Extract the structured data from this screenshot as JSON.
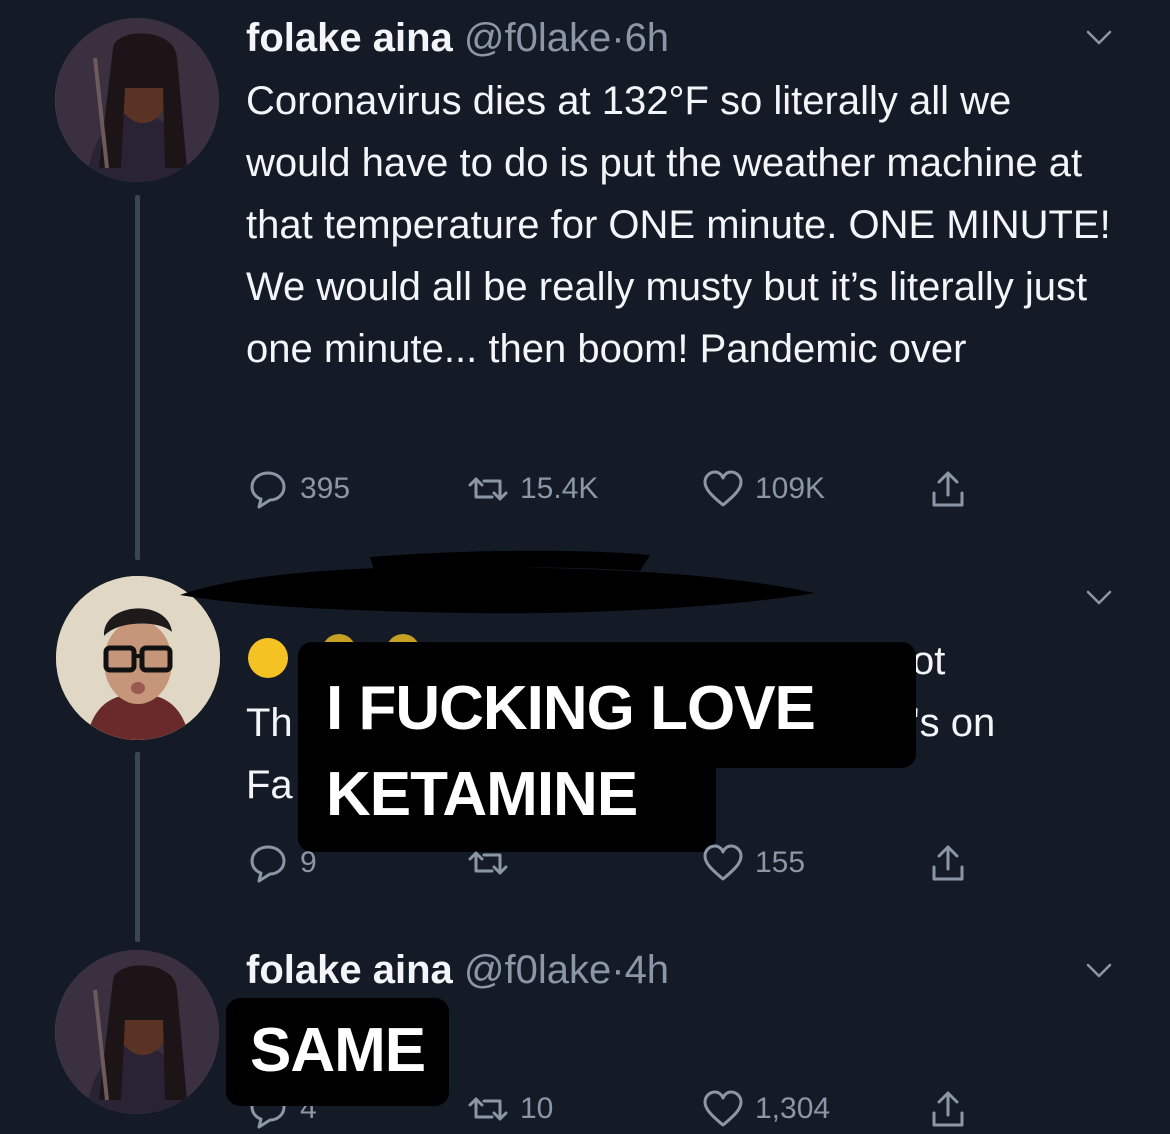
{
  "colors": {
    "background": "#141b26",
    "muted": "#8b97a6",
    "text": "#f3f5f8",
    "thread_line": "#3c4653",
    "overlay_bg": "#000000",
    "emoji": "#f4c223"
  },
  "tweets": [
    {
      "name": "folake aina",
      "handle": "@f0lake",
      "dot": "·",
      "time": "6h",
      "text": "Coronavirus dies at 132°F so literally all we would have to do is put the weather machine at that temperature for ONE minute. ONE MINUTE! We would all be really musty but it’s literally just one minute... then boom! Pandemic over",
      "replies": "395",
      "retweets": "15.4K",
      "likes": "109K"
    },
    {
      "visible_text_line1_end": "ot",
      "visible_text_line2_start": "Th",
      "visible_text_line2_end": "'s on",
      "visible_text_line3_start": "Fa",
      "replies": "9",
      "retweets": "",
      "likes": "155",
      "overlay": "I FUCKING LOVE KETAMINE"
    },
    {
      "name": "folake aina",
      "handle": "@f0lake",
      "dot": "·",
      "time": "4h",
      "overlay": "SAME",
      "replies": "4",
      "retweets": "10",
      "likes": "1,304"
    }
  ],
  "icons": [
    "reply-icon",
    "retweet-icon",
    "like-icon",
    "share-icon",
    "chevron-down-icon"
  ]
}
